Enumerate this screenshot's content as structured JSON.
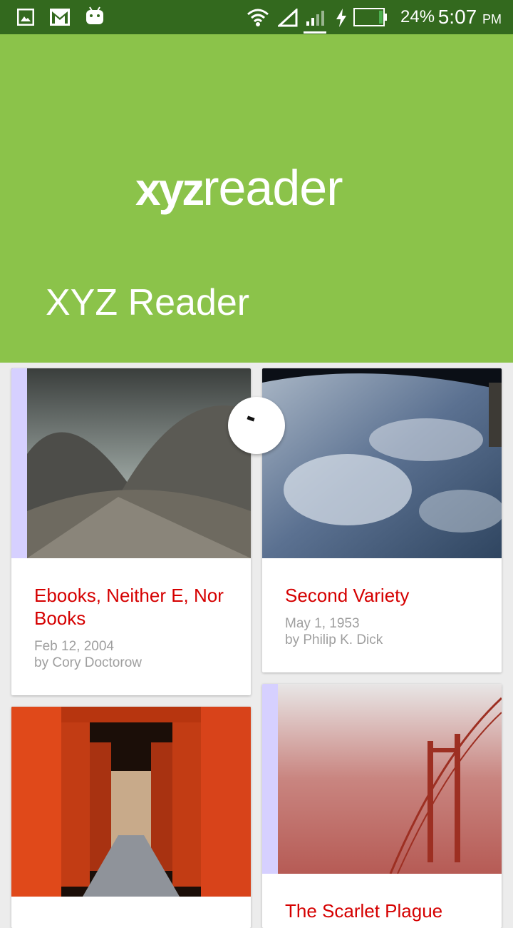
{
  "status_bar": {
    "battery": "24%",
    "time": "5:07",
    "ampm": "PM",
    "icons": [
      "image-icon",
      "gmail-icon",
      "android-icon",
      "wifi-icon",
      "signal-icon",
      "signal-bars-icon",
      "charging-icon",
      "battery-icon"
    ]
  },
  "app_bar": {
    "logo_bold": "xyz",
    "logo_light": "reader",
    "title": "XYZ Reader",
    "color": "#8bc34a",
    "status_color": "#33691e"
  },
  "articles": [
    {
      "title": "Ebooks, Neither E, Nor Books",
      "date": "Feb 12, 2004",
      "author": "by Cory Doctorow"
    },
    {
      "title": "Second Variety",
      "date": "May 1, 1953",
      "author": "by Philip K. Dick"
    },
    {
      "title": "",
      "date": "",
      "author": ""
    },
    {
      "title": "The Scarlet Plague",
      "date": "",
      "author": ""
    }
  ],
  "accent_color": "#d50000"
}
